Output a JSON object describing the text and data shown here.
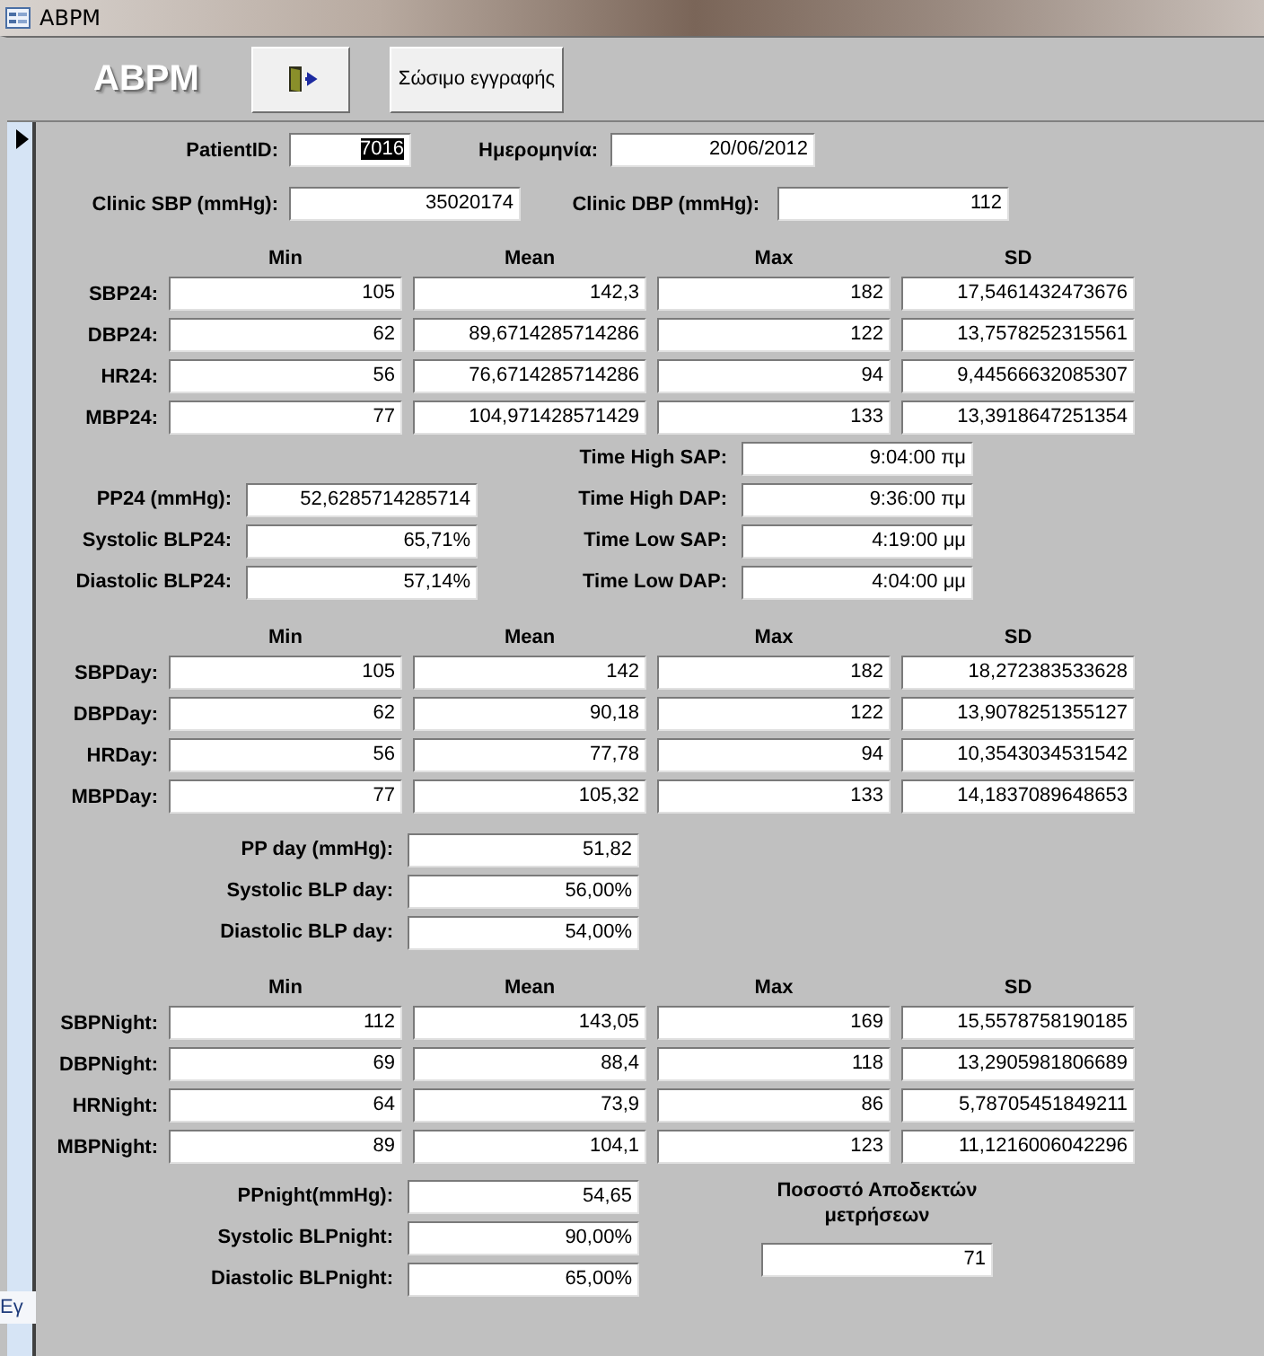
{
  "window": {
    "title": "ABPM"
  },
  "header": {
    "logo": "ABPM",
    "save_button": "Σώσιμο εγγραφής"
  },
  "record_fields": [
    {
      "label": "PatientID:",
      "value": "7016",
      "selected": true
    },
    {
      "label": "Ημερομηνία:",
      "value": "20/06/2012",
      "selected": false
    },
    {
      "label": "Clinic SBP (mmHg):",
      "value": "35020174",
      "selected": false
    },
    {
      "label": "Clinic DBP (mmHg):",
      "value": "112",
      "selected": false
    }
  ],
  "blocks": [
    {
      "columns": [
        "Min",
        "Mean",
        "Max",
        "SD"
      ],
      "rows": [
        {
          "label": "SBP24:",
          "values": [
            "105",
            "142,3",
            "182",
            "17,5461432473676"
          ]
        },
        {
          "label": "DBP24:",
          "values": [
            "62",
            "89,6714285714286",
            "122",
            "13,7578252315561"
          ]
        },
        {
          "label": "HR24:",
          "values": [
            "56",
            "76,6714285714286",
            "94",
            "9,44566632085307"
          ]
        },
        {
          "label": "MBP24:",
          "values": [
            "77",
            "104,971428571429",
            "133",
            "13,3918647251354"
          ]
        }
      ],
      "left": [
        {
          "label": "PP24 (mmHg):",
          "value": "52,6285714285714"
        },
        {
          "label": "Systolic BLP24:",
          "value": "65,71%"
        },
        {
          "label": "Diastolic BLP24:",
          "value": "57,14%"
        }
      ],
      "right": [
        {
          "label": "Time High SAP:",
          "value": "9:04:00 πμ"
        },
        {
          "label": "Time High DAP:",
          "value": "9:36:00 πμ"
        },
        {
          "label": "Time Low SAP:",
          "value": "4:19:00 μμ"
        },
        {
          "label": "Time Low DAP:",
          "value": "4:04:00 μμ"
        }
      ]
    },
    {
      "columns": [
        "Min",
        "Mean",
        "Max",
        "SD"
      ],
      "rows": [
        {
          "label": "SBPDay:",
          "values": [
            "105",
            "142",
            "182",
            "18,272383533628"
          ]
        },
        {
          "label": "DBPDay:",
          "values": [
            "62",
            "90,18",
            "122",
            "13,9078251355127"
          ]
        },
        {
          "label": "HRDay:",
          "values": [
            "56",
            "77,78",
            "94",
            "10,3543034531542"
          ]
        },
        {
          "label": "MBPDay:",
          "values": [
            "77",
            "105,32",
            "133",
            "14,1837089648653"
          ]
        }
      ],
      "left": [
        {
          "label": "PP day (mmHg):",
          "value": "51,82"
        },
        {
          "label": "Systolic BLP day:",
          "value": "56,00%"
        },
        {
          "label": "Diastolic BLP day:",
          "value": "54,00%"
        }
      ]
    },
    {
      "columns": [
        "Min",
        "Mean",
        "Max",
        "SD"
      ],
      "rows": [
        {
          "label": "SBPNight:",
          "values": [
            "112",
            "143,05",
            "169",
            "15,5578758190185"
          ]
        },
        {
          "label": "DBPNight:",
          "values": [
            "69",
            "88,4",
            "118",
            "13,2905981806689"
          ]
        },
        {
          "label": "HRNight:",
          "values": [
            "64",
            "73,9",
            "86",
            "5,78705451849211"
          ]
        },
        {
          "label": "MBPNight:",
          "values": [
            "89",
            "104,1",
            "123",
            "11,1216006042296"
          ]
        }
      ],
      "left": [
        {
          "label": "PPnight(mmHg):",
          "value": "54,65"
        },
        {
          "label": "Systolic BLPnight:",
          "value": "90,00%"
        },
        {
          "label": "Diastolic BLPnight:",
          "value": "65,00%"
        }
      ],
      "acceptance": {
        "label": "Ποσοστό Αποδεκτών μετρήσεων",
        "value": "71"
      }
    }
  ],
  "record_tab": "Εγ"
}
